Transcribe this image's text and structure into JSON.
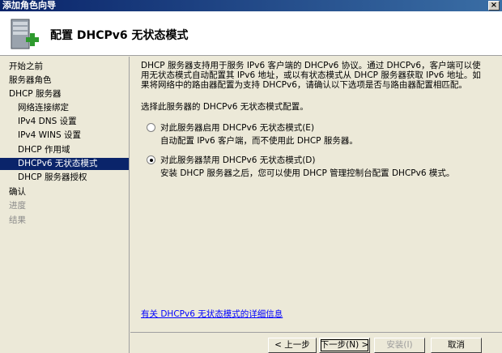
{
  "window": {
    "title": "添加角色向导",
    "close_glyph": "×"
  },
  "header": {
    "title": "配置 DHCPv6 无状态模式"
  },
  "sidebar": {
    "items": [
      {
        "label": "开始之前"
      },
      {
        "label": "服务器角色"
      },
      {
        "label": "DHCP 服务器"
      },
      {
        "label": "网络连接绑定"
      },
      {
        "label": "IPv4 DNS 设置"
      },
      {
        "label": "IPv4 WINS 设置"
      },
      {
        "label": "DHCP 作用域"
      },
      {
        "label": "DHCPv6 无状态模式"
      },
      {
        "label": "DHCP 服务器授权"
      },
      {
        "label": "确认"
      },
      {
        "label": "进度"
      },
      {
        "label": "结果"
      }
    ]
  },
  "content": {
    "intro": "DHCP 服务器支持用于服务 IPv6 客户端的 DHCPv6 协议。通过 DHCPv6，客户端可以使用无状态模式自动配置其 IPv6 地址，或以有状态模式从 DHCP 服务器获取 IPv6 地址。如果将网络中的路由器配置为支持 DHCPv6，请确认以下选项是否与路由器配置相匹配。",
    "prompt": "选择此服务器的 DHCPv6 无状态模式配置。",
    "options": [
      {
        "label": "对此服务器启用 DHCPv6 无状态模式(E)",
        "desc": "自动配置 IPv6 客户端，而不使用此 DHCP 服务器。",
        "checked": false
      },
      {
        "label": "对此服务器禁用 DHCPv6 无状态模式(D)",
        "desc": "安装 DHCP 服务器之后，您可以使用 DHCP 管理控制台配置 DHCPv6 模式。",
        "checked": true
      }
    ],
    "help_link": "有关 DHCPv6 无状态模式的详细信息"
  },
  "footer": {
    "back": "< 上一步(P)",
    "next": "下一步(N) >",
    "install": "安装(I)",
    "cancel": "取消"
  }
}
